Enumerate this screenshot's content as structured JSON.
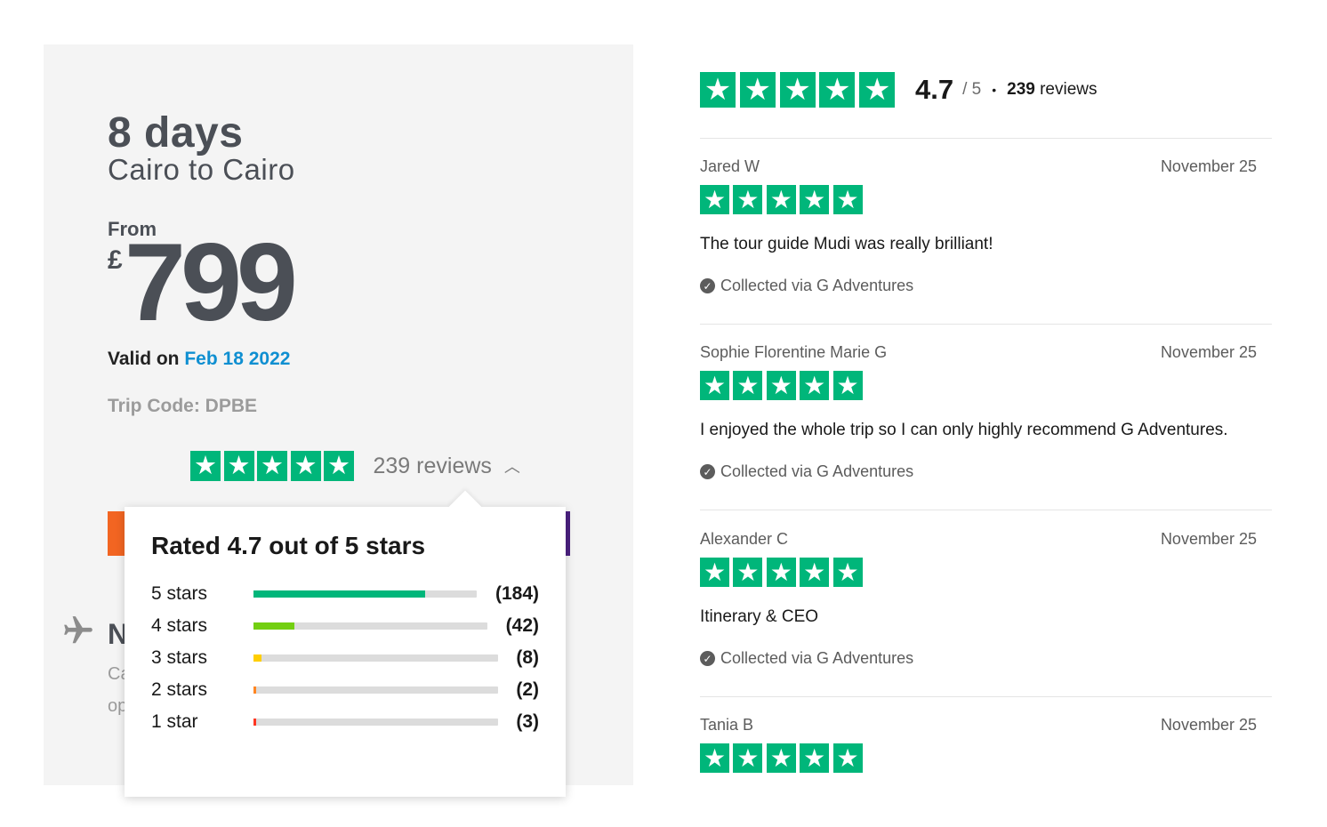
{
  "trip": {
    "duration": "8 days",
    "route": "Cairo to Cairo",
    "from_label": "From",
    "currency": "£",
    "price": "799",
    "valid_prefix": "Valid on",
    "valid_date": "Feb 18 2022",
    "trip_code": "Trip Code: DPBE",
    "review_count_label": "239 reviews",
    "hidden_title": "N",
    "hidden_line_1": "Ca",
    "hidden_line_2": "op"
  },
  "popover": {
    "title": "Rated 4.7 out of 5 stars",
    "rows": [
      {
        "label": "5 stars",
        "count": "(184)",
        "share": 0.767,
        "color": "#00b67a"
      },
      {
        "label": "4 stars",
        "count": "(42)",
        "share": 0.175,
        "color": "#73cf11"
      },
      {
        "label": "3 stars",
        "count": "(8)",
        "share": 0.033,
        "color": "#ffce00"
      },
      {
        "label": "2 stars",
        "count": "(2)",
        "share": 0.008,
        "color": "#ff8622"
      },
      {
        "label": "1 star",
        "count": "(3)",
        "share": 0.012,
        "color": "#ff3722"
      }
    ]
  },
  "summary": {
    "score": "4.7",
    "out_of": "/ 5",
    "separator": "•",
    "reviews_number": "239",
    "reviews_word": "reviews"
  },
  "reviews": [
    {
      "author": "Jared W",
      "date": "November 25",
      "stars": 5,
      "text": "The tour guide Mudi was really brilliant!",
      "source": "Collected via G Adventures"
    },
    {
      "author": "Sophie Florentine Marie G",
      "date": "November 25",
      "stars": 5,
      "text": "I enjoyed the whole trip so I can only highly recommend G Adventures.",
      "source": "Collected via G Adventures"
    },
    {
      "author": "Alexander C",
      "date": "November 25",
      "stars": 5,
      "text": "Itinerary & CEO",
      "source": "Collected via G Adventures"
    },
    {
      "author": "Tania B",
      "date": "November 25",
      "stars": 5,
      "text": "",
      "source": ""
    }
  ],
  "icons": {
    "star": "star-icon",
    "plane": "plane-icon",
    "chevron": "chevron-up-icon",
    "check": "check-circle-icon"
  },
  "colors": {
    "trustpilot_green": "#00b67a",
    "link_blue": "#0f8fd1",
    "card_bg": "#f4f4f4"
  }
}
